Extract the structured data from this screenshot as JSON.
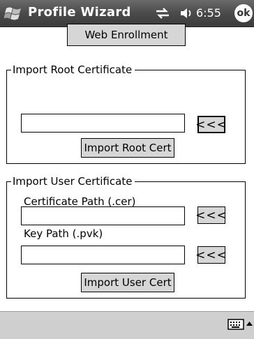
{
  "titlebar": {
    "title": "Profile Wizard",
    "time": "6:55",
    "ok_label": "ok",
    "icons": [
      "windows-start-icon",
      "connectivity-icon",
      "speaker-icon"
    ]
  },
  "web_enrollment": {
    "label": "Web Enrollment"
  },
  "root_group": {
    "legend": "Import Root Certificate",
    "path_value": "",
    "browse_label": "<<<",
    "import_label": "Import Root Cert"
  },
  "user_group": {
    "legend": "Import User Certificate",
    "cert_path_label": "Certificate Path (.cer)",
    "cert_path_value": "",
    "cert_browse_label": "<<<",
    "key_path_label": "Key Path (.pvk)",
    "key_path_value": "",
    "key_browse_label": "<<<",
    "import_label": "Import User Cert"
  },
  "bottombar": {
    "icons": [
      "keyboard-icon",
      "sip-arrow-up-icon"
    ]
  },
  "colors": {
    "titlebar": "#4a4a4a",
    "button_face": "#d6d6d6",
    "menubar": "#cfcfcf"
  }
}
